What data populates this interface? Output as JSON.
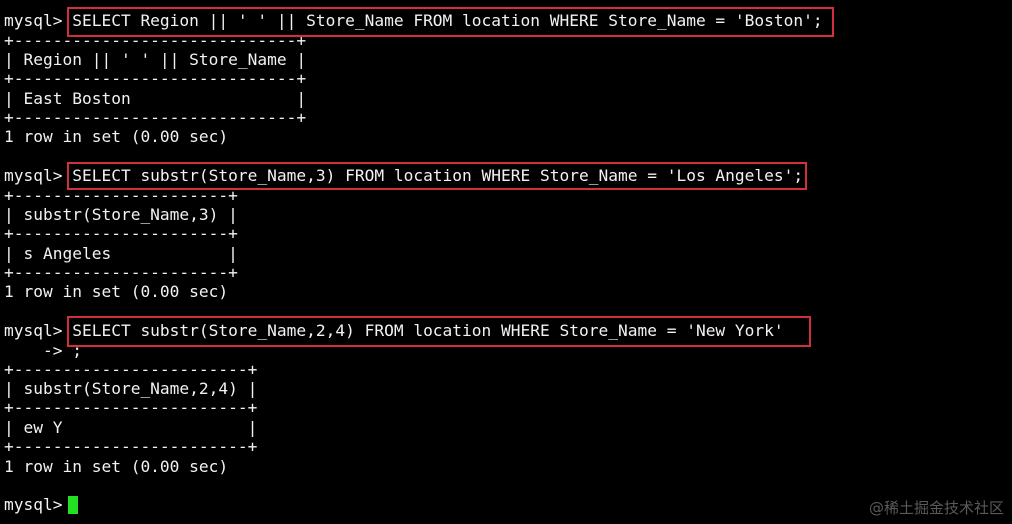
{
  "terminal": {
    "lines": [
      "mysql> SELECT Region || ' ' || Store_Name FROM location WHERE Store_Name = 'Boston';",
      "+-----------------------------+",
      "| Region || ' ' || Store_Name |",
      "+-----------------------------+",
      "| East Boston                 |",
      "+-----------------------------+",
      "1 row in set (0.00 sec)",
      "mysql> SELECT substr(Store_Name,3) FROM location WHERE Store_Name = 'Los Angeles';",
      "+----------------------+",
      "| substr(Store_Name,3) |",
      "+----------------------+",
      "| s Angeles            |",
      "+----------------------+",
      "1 row in set (0.00 sec)",
      "mysql> SELECT substr(Store_Name,2,4) FROM location WHERE Store_Name = 'New York'",
      "    -> ;",
      "+------------------------+",
      "| substr(Store_Name,2,4) |",
      "+------------------------+",
      "| ew Y                   |",
      "+------------------------+",
      "1 row in set (0.00 sec)",
      "mysql> "
    ]
  },
  "watermark": "@稀土掘金技术社区",
  "colors": {
    "background": "#000000",
    "text": "#f2f2f2",
    "highlight_border": "#d0313b",
    "cursor": "#23e023"
  }
}
